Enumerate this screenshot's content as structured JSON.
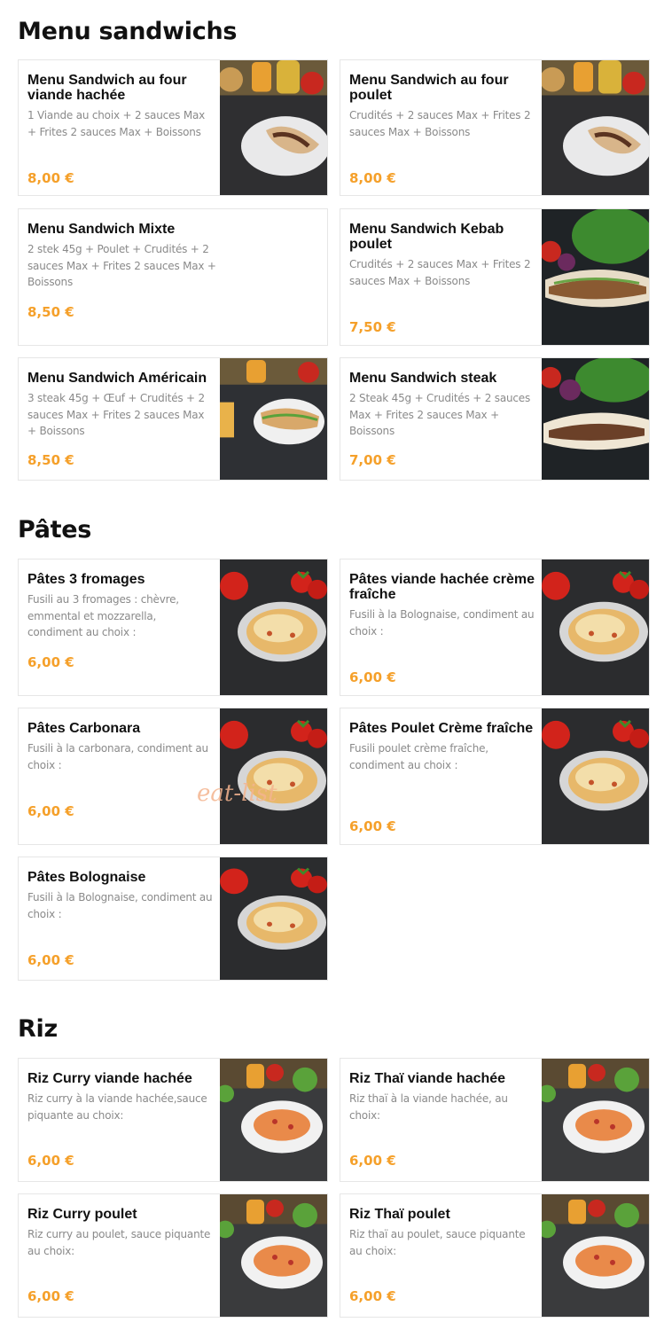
{
  "sections": {
    "sandwichs": {
      "title": "Menu sandwichs"
    },
    "pates": {
      "title": "Pâtes"
    },
    "riz": {
      "title": "Riz"
    }
  },
  "watermark": "eat-list",
  "colors": {
    "price": "#f5a02a",
    "border": "#e6e6e6",
    "desc": "#8a8a8a"
  },
  "items": [
    {
      "name": "Menu Sandwich au four viande hachée",
      "desc": "1 Viande au choix + 2 sauces Max + Frites 2 sauces Max + Boissons",
      "price": "8,00 €",
      "photo": "sandwich-plate-photo"
    },
    {
      "name": "Menu Sandwich au four poulet",
      "desc": "Crudités + 2 sauces Max + Frites 2 sauces Max + Boissons",
      "price": "8,00 €",
      "photo": "sandwich-plate-photo"
    },
    {
      "name": "Menu Sandwich Mixte",
      "desc": "2 stek 45g + Poulet + Crudités + 2 sauces Max + Frites 2 sauces Max + Boissons",
      "price": "8,50 €",
      "photo": ""
    },
    {
      "name": "Menu Sandwich Kebab poulet",
      "desc": "Crudités + 2 sauces Max + Frites 2 sauces Max + Boissons",
      "price": "7,50 €",
      "photo": "kebab-sandwich-photo"
    },
    {
      "name": "Menu Sandwich Américain",
      "desc": "3 steak 45g + Œuf + Crudités + 2 sauces Max + Frites 2 sauces Max + Boissons",
      "price": "8,50 €",
      "photo": "american-sandwich-photo"
    },
    {
      "name": "Menu Sandwich steak",
      "desc": "2 Steak 45g + Crudités + 2 sauces Max + Frites 2 sauces Max + Boissons",
      "price": "7,00 €",
      "photo": "steak-sandwich-photo"
    },
    {
      "name": "Pâtes 3 fromages",
      "desc": "Fusili au 3 fromages : chèvre, emmental et mozzarella, condiment au choix :",
      "price": "6,00 €",
      "photo": "pasta-bowl-photo"
    },
    {
      "name": "Pâtes viande hachée crème fraîche",
      "desc": "Fusili à la Bolognaise, condiment au choix :",
      "price": "6,00 €",
      "photo": "pasta-bowl-photo"
    },
    {
      "name": "Pâtes Carbonara",
      "desc": "Fusili à la carbonara, condiment au choix :",
      "price": "6,00 €",
      "photo": "pasta-bowl-photo"
    },
    {
      "name": "Pâtes Poulet Crème fraîche",
      "desc": "Fusili poulet crème fraîche, condiment au choix :",
      "price": "6,00 €",
      "photo": "pasta-bowl-photo"
    },
    {
      "name": "Pâtes Bolognaise",
      "desc": "Fusili à la Bolognaise, condiment au choix :",
      "price": "6,00 €",
      "photo": "pasta-bowl-photo"
    },
    {
      "name": "Riz Curry viande hachée",
      "desc": "Riz curry à la viande hachée,sauce piquante au choix:",
      "price": "6,00 €",
      "photo": "rice-bowl-photo"
    },
    {
      "name": "Riz Thaï viande hachée",
      "desc": "Riz thaï à la viande hachée, au choix:",
      "price": "6,00 €",
      "photo": "rice-bowl-photo"
    },
    {
      "name": "Riz Curry poulet",
      "desc": "Riz curry au poulet, sauce piquante au choix:",
      "price": "6,00 €",
      "photo": "rice-bowl-photo"
    },
    {
      "name": "Riz Thaï poulet",
      "desc": "Riz thaï au poulet, sauce piquante au choix:",
      "price": "6,00 €",
      "photo": "rice-bowl-photo"
    }
  ]
}
